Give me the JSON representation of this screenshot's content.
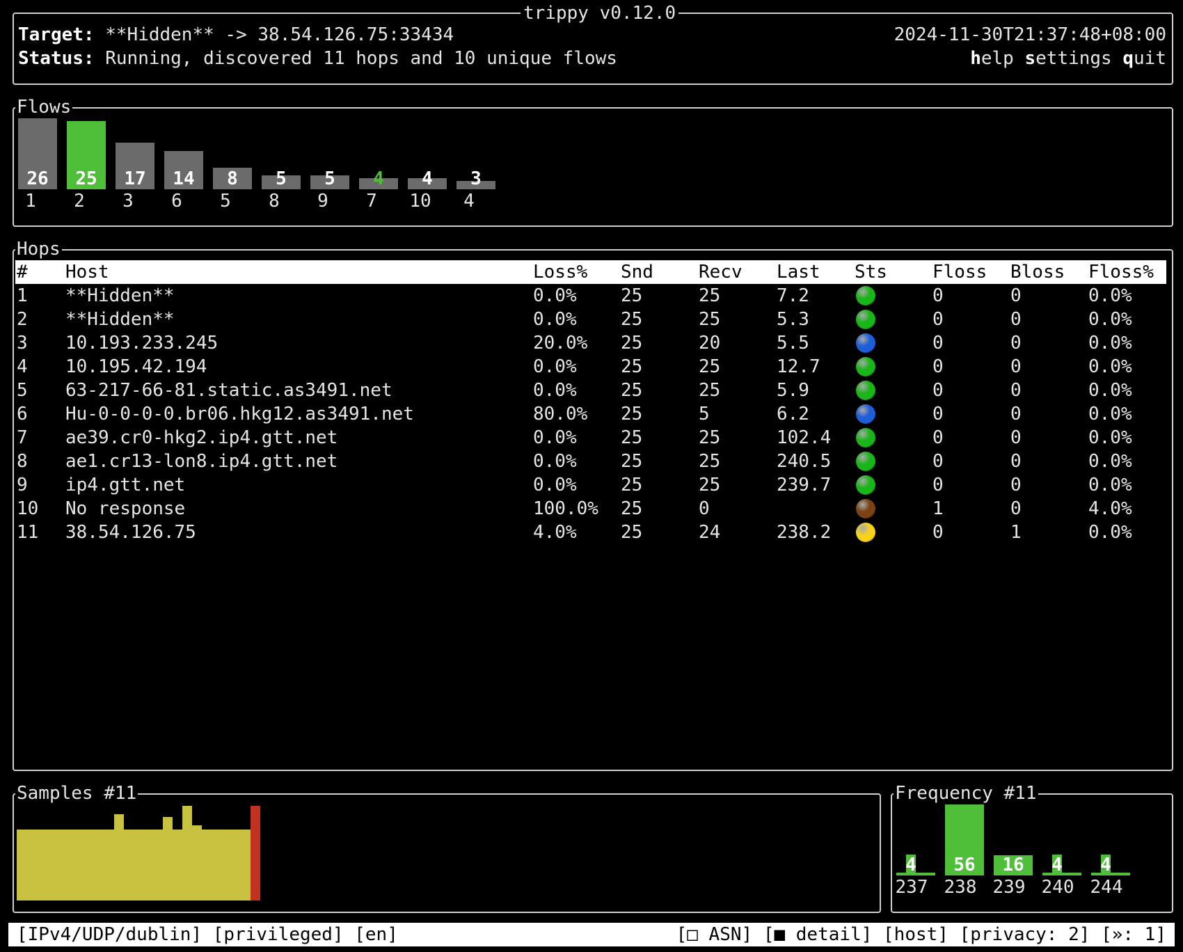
{
  "app": {
    "title": "trippy v0.12.0"
  },
  "header": {
    "target_label": "Target:",
    "target_value": "**Hidden** -> 38.54.126.75:33434",
    "status_label": "Status:",
    "status_value": "Running, discovered 11 hops and 10 unique flows",
    "timestamp": "2024-11-30T21:37:48+08:00",
    "menu": {
      "help": {
        "key": "h",
        "rest": "elp"
      },
      "settings": {
        "key": "s",
        "rest": "ettings"
      },
      "quit": {
        "key": "q",
        "rest": "uit"
      }
    }
  },
  "flows": {
    "title": "Flows",
    "items": [
      {
        "value": "26",
        "label": "1",
        "selected": false
      },
      {
        "value": "25",
        "label": "2",
        "selected": true
      },
      {
        "value": "17",
        "label": "3",
        "selected": false
      },
      {
        "value": "14",
        "label": "6",
        "selected": false
      },
      {
        "value": "8",
        "label": "5",
        "selected": false
      },
      {
        "value": "5",
        "label": "8",
        "selected": false
      },
      {
        "value": "5",
        "label": "9",
        "selected": false
      },
      {
        "value": "4",
        "label": "7",
        "selected": false
      },
      {
        "value": "4",
        "label": "10",
        "selected": false
      },
      {
        "value": "3",
        "label": "4",
        "selected": false
      }
    ]
  },
  "hops": {
    "title": "Hops",
    "columns": [
      "#",
      "Host",
      "Loss%",
      "Snd",
      "Recv",
      "Last",
      "Sts",
      "Floss",
      "Bloss",
      "Floss%"
    ],
    "rows": [
      {
        "n": "1",
        "host": "**Hidden**",
        "loss": "0.0%",
        "snd": "25",
        "recv": "25",
        "last": "7.2",
        "sts": "green",
        "floss": "0",
        "bloss": "0",
        "flossp": "0.0%"
      },
      {
        "n": "2",
        "host": "**Hidden**",
        "loss": "0.0%",
        "snd": "25",
        "recv": "25",
        "last": "5.3",
        "sts": "green",
        "floss": "0",
        "bloss": "0",
        "flossp": "0.0%"
      },
      {
        "n": "3",
        "host": "10.193.233.245",
        "loss": "20.0%",
        "snd": "25",
        "recv": "20",
        "last": "5.5",
        "sts": "blue",
        "floss": "0",
        "bloss": "0",
        "flossp": "0.0%"
      },
      {
        "n": "4",
        "host": "10.195.42.194",
        "loss": "0.0%",
        "snd": "25",
        "recv": "25",
        "last": "12.7",
        "sts": "green",
        "floss": "0",
        "bloss": "0",
        "flossp": "0.0%"
      },
      {
        "n": "5",
        "host": "63-217-66-81.static.as3491.net",
        "loss": "0.0%",
        "snd": "25",
        "recv": "25",
        "last": "5.9",
        "sts": "green",
        "floss": "0",
        "bloss": "0",
        "flossp": "0.0%"
      },
      {
        "n": "6",
        "host": "Hu-0-0-0-0.br06.hkg12.as3491.net",
        "loss": "80.0%",
        "snd": "25",
        "recv": "5",
        "last": "6.2",
        "sts": "blue",
        "floss": "0",
        "bloss": "0",
        "flossp": "0.0%"
      },
      {
        "n": "7",
        "host": "ae39.cr0-hkg2.ip4.gtt.net",
        "loss": "0.0%",
        "snd": "25",
        "recv": "25",
        "last": "102.4",
        "sts": "green",
        "floss": "0",
        "bloss": "0",
        "flossp": "0.0%"
      },
      {
        "n": "8",
        "host": "ae1.cr13-lon8.ip4.gtt.net",
        "loss": "0.0%",
        "snd": "25",
        "recv": "25",
        "last": "240.5",
        "sts": "green",
        "floss": "0",
        "bloss": "0",
        "flossp": "0.0%"
      },
      {
        "n": "9",
        "host": "ip4.gtt.net",
        "loss": "0.0%",
        "snd": "25",
        "recv": "25",
        "last": "239.7",
        "sts": "green",
        "floss": "0",
        "bloss": "0",
        "flossp": "0.0%"
      },
      {
        "n": "10",
        "host": "No response",
        "loss": "100.0%",
        "snd": "25",
        "recv": "0",
        "last": "",
        "sts": "brown",
        "floss": "1",
        "bloss": "0",
        "flossp": "4.0%"
      },
      {
        "n": "11",
        "host": "38.54.126.75",
        "loss": "4.0%",
        "snd": "25",
        "recv": "24",
        "last": "238.2",
        "sts": "yellow",
        "floss": "0",
        "bloss": "1",
        "flossp": "0.0%"
      }
    ]
  },
  "samples": {
    "title": "Samples #11"
  },
  "frequency": {
    "title": "Frequency #11",
    "items": [
      {
        "value": "4",
        "label": "237"
      },
      {
        "value": "56",
        "label": "238"
      },
      {
        "value": "16",
        "label": "239"
      },
      {
        "value": "4",
        "label": "240"
      },
      {
        "value": "4",
        "label": "244"
      }
    ]
  },
  "statusbar": {
    "left": "[IPv4/UDP/dublin] [privileged] [en]",
    "right": "[□ ASN] [■ detail] [host] [privacy: 2] [»: 1]"
  },
  "colors": {
    "green_bar": "#4fbf3a",
    "gray_bar": "#6b6b6b",
    "yellow_samples": "#c8c13f",
    "red_marker": "#c0321e",
    "sts_green": "#19b519",
    "sts_blue": "#1d5fd8",
    "sts_brown": "#7a4215",
    "sts_yellow": "#f7d21a"
  }
}
